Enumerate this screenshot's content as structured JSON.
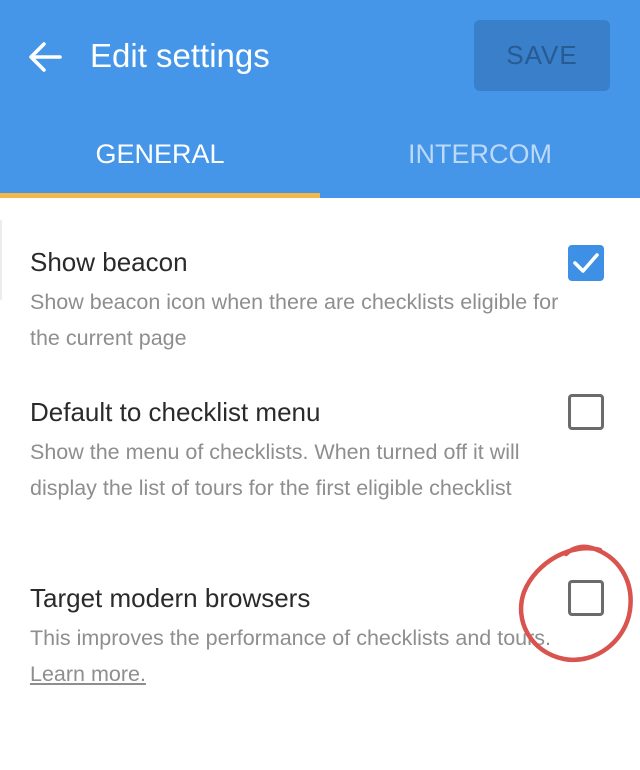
{
  "header": {
    "title": "Edit settings",
    "save_label": "SAVE",
    "back_icon": "arrow-left-icon",
    "background_color": "#4596e8"
  },
  "tabs": [
    {
      "label": "GENERAL",
      "active": true
    },
    {
      "label": "INTERCOM",
      "active": false
    }
  ],
  "settings": [
    {
      "title": "Show beacon",
      "description": "Show beacon icon when there are checklists eligible for the current page",
      "checked": true
    },
    {
      "title": "Default to checklist menu",
      "description": "Show the menu of checklists. When turned off it will display the list of tours for the first eligible checklist",
      "checked": false
    },
    {
      "title": "Target modern browsers",
      "description": "This improves the performance of checklists and tours.",
      "link_text": "Learn more.",
      "checked": false
    }
  ],
  "colors": {
    "accent": "#3e8fe6",
    "tab_indicator": "#f4b84a",
    "annotation": "#d9534f"
  }
}
